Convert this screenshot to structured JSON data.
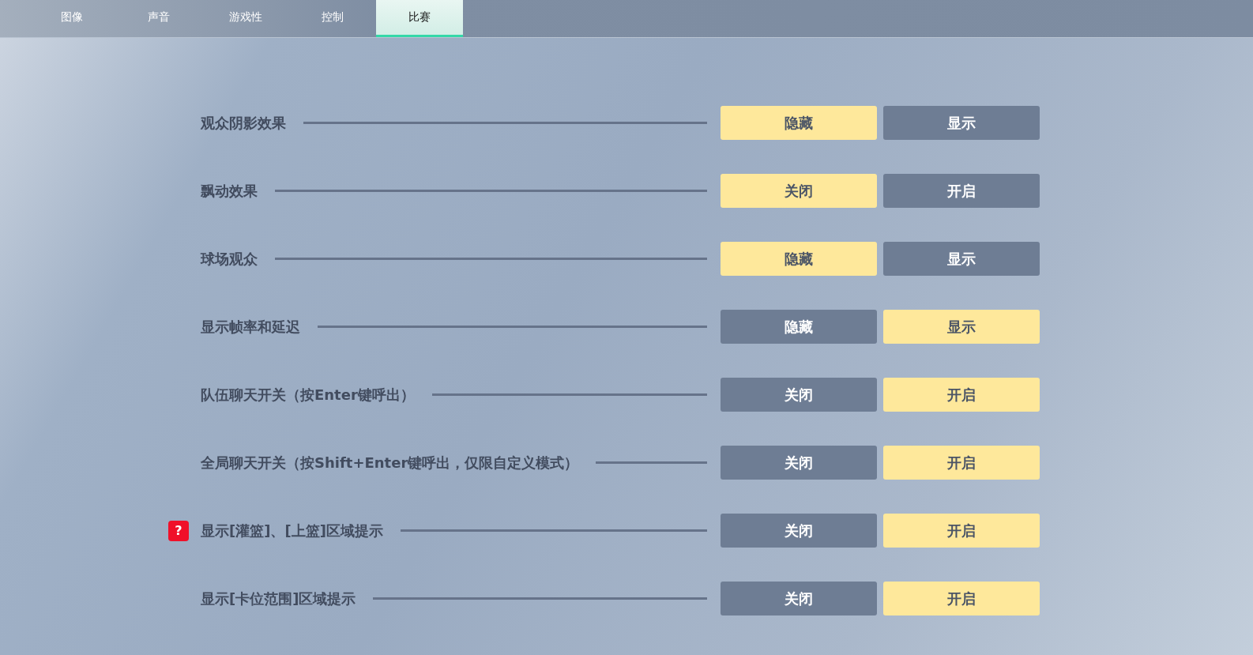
{
  "tabs": [
    {
      "label": "图像",
      "selected": false
    },
    {
      "label": "声音",
      "selected": false
    },
    {
      "label": "游戏性",
      "selected": false
    },
    {
      "label": "控制",
      "selected": false
    },
    {
      "label": "比赛",
      "selected": true
    }
  ],
  "settings": [
    {
      "label": "观众阴影效果",
      "options": [
        {
          "label": "隐藏",
          "selected": true
        },
        {
          "label": "显示",
          "selected": false
        }
      ]
    },
    {
      "label": "飘动效果",
      "options": [
        {
          "label": "关闭",
          "selected": true
        },
        {
          "label": "开启",
          "selected": false
        }
      ]
    },
    {
      "label": "球场观众",
      "options": [
        {
          "label": "隐藏",
          "selected": true
        },
        {
          "label": "显示",
          "selected": false
        }
      ]
    },
    {
      "label": "显示帧率和延迟",
      "options": [
        {
          "label": "隐藏",
          "selected": false
        },
        {
          "label": "显示",
          "selected": true
        }
      ]
    },
    {
      "label": "队伍聊天开关（按Enter键呼出）",
      "options": [
        {
          "label": "关闭",
          "selected": false
        },
        {
          "label": "开启",
          "selected": true
        }
      ]
    },
    {
      "label": "全局聊天开关（按Shift+Enter键呼出，仅限自定义模式）",
      "options": [
        {
          "label": "关闭",
          "selected": false
        },
        {
          "label": "开启",
          "selected": true
        }
      ]
    },
    {
      "label": "显示[灌篮]、[上篮]区域提示",
      "help": "?",
      "options": [
        {
          "label": "关闭",
          "selected": false
        },
        {
          "label": "开启",
          "selected": true
        }
      ]
    },
    {
      "label": "显示[卡位范围]区域提示",
      "options": [
        {
          "label": "关闭",
          "selected": false
        },
        {
          "label": "开启",
          "selected": true
        }
      ]
    }
  ]
}
